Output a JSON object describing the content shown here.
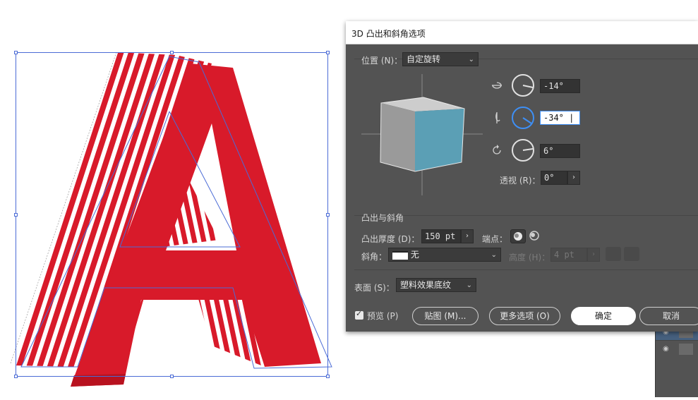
{
  "dialog": {
    "title": "3D 凸出和斜角选项",
    "position_label": "位置 (N)：",
    "position_value": "自定旋转",
    "rot_x": "-14°",
    "rot_y": "-34°",
    "rot_z": "6°",
    "perspective_label": "透视 (R)：",
    "perspective_value": "0°",
    "extrude_section": "凸出与斜角",
    "extrude_depth_label": "凸出厚度 (D)：",
    "extrude_depth_value": "150 pt",
    "cap_label": "端点：",
    "bevel_label": "斜角：",
    "bevel_value": "无",
    "height_label": "高度 (H)：",
    "height_value": "4 pt",
    "surface_label": "表面 (S)：",
    "surface_value": "塑料效果底纹",
    "preview_label": "预览 (P)",
    "preview_checked": true,
    "map_button": "贴图 (M)...",
    "more_options_button": "更多选项 (O)",
    "ok_button": "确定",
    "cancel_button": "取消"
  },
  "colors": {
    "letter_red": "#d81a2a",
    "stripe_white": "#ffffff",
    "selection_blue": "#4b6bd6",
    "cube_front": "#5b9fb5",
    "cube_side": "#9a9a9a",
    "cube_top": "#cdcdcd",
    "dialog_bg": "#535353",
    "active_knob": "#3e8ff5"
  },
  "icons": {
    "rotate_x": "rotate-x-icon",
    "rotate_y": "rotate-y-icon",
    "rotate_z": "rotate-z-icon",
    "cap_on": "cap-on-icon",
    "cap_off": "cap-off-icon",
    "eye": "eye-icon"
  }
}
